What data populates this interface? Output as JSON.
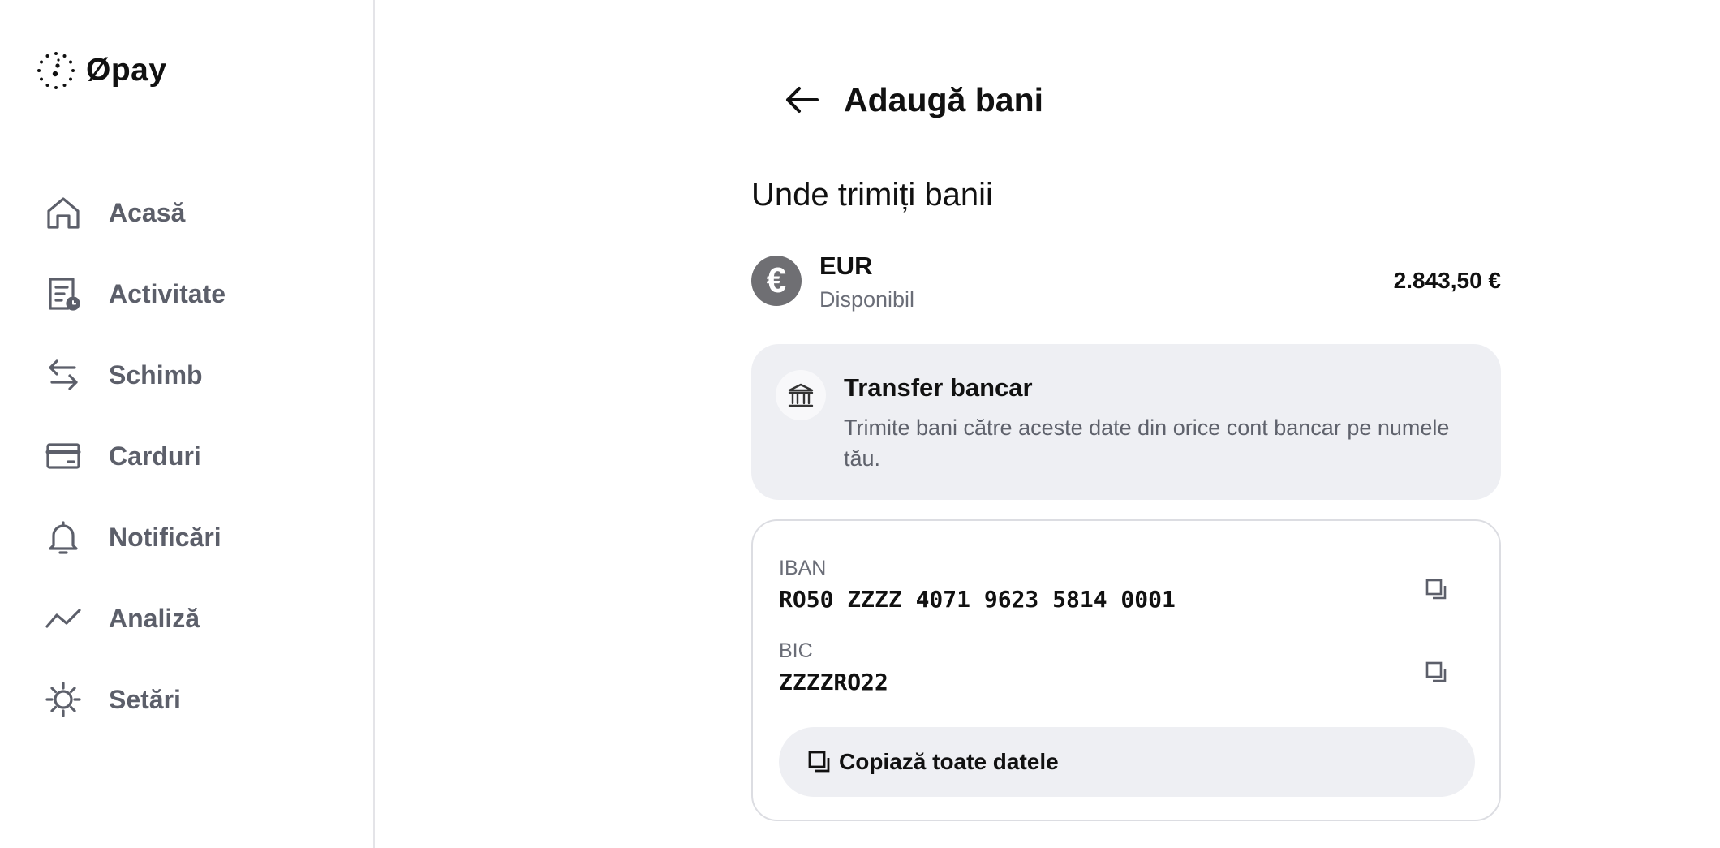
{
  "app": {
    "name": "Øpay"
  },
  "sidebar": {
    "items": [
      {
        "label": "Acasă",
        "icon": "home-icon"
      },
      {
        "label": "Activitate",
        "icon": "activity-icon"
      },
      {
        "label": "Schimb",
        "icon": "exchange-icon"
      },
      {
        "label": "Carduri",
        "icon": "card-icon"
      },
      {
        "label": "Notificări",
        "icon": "bell-icon"
      },
      {
        "label": "Analiză",
        "icon": "chart-line-icon"
      },
      {
        "label": "Setări",
        "icon": "gear-icon"
      }
    ]
  },
  "header": {
    "title": "Adaugă bani",
    "back_icon": "arrow-left-icon"
  },
  "section": {
    "title": "Unde trimiți banii"
  },
  "account": {
    "currency_symbol": "€",
    "currency": "EUR",
    "status": "Disponibil",
    "amount": "2.843,50 €"
  },
  "info": {
    "title": "Transfer bancar",
    "description": "Trimite bani către aceste date din orice cont bancar pe numele tău.",
    "icon": "bank-icon"
  },
  "details": {
    "iban_label": "IBAN",
    "iban_value": "RO50 ZZZZ 4071 9623 5814 0001",
    "bic_label": "BIC",
    "bic_value": "ZZZZRO22",
    "copy_all_label": "Copiază toate datele"
  },
  "colors": {
    "text": "#111114",
    "muted": "#5c5f6a",
    "card_bg": "#eeeff3",
    "border": "#dcdde2",
    "currency_badge": "#6f6f73"
  }
}
